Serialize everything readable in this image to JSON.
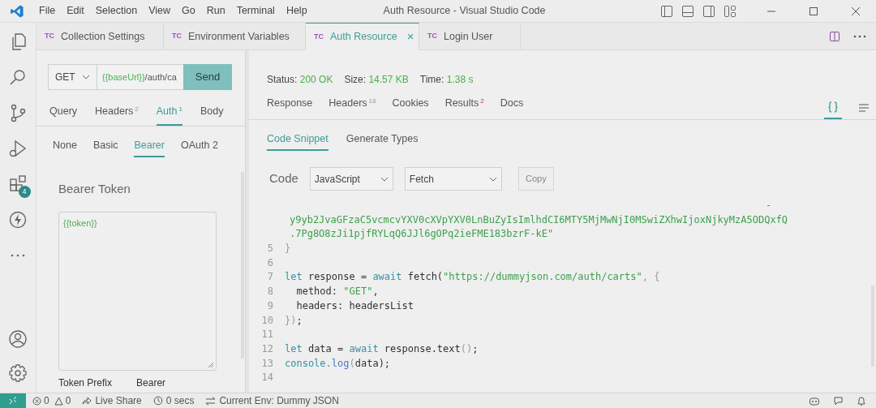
{
  "menu": [
    "File",
    "Edit",
    "Selection",
    "View",
    "Go",
    "Run",
    "Terminal",
    "Help"
  ],
  "window": {
    "title": "Auth Resource - Visual Studio Code"
  },
  "activity_bar": [
    {
      "kind": "files"
    },
    {
      "kind": "search"
    },
    {
      "kind": "scm"
    },
    {
      "kind": "debug"
    },
    {
      "kind": "extensions",
      "badge": "4"
    },
    {
      "kind": "bolt"
    },
    {
      "kind": "more"
    }
  ],
  "editor_tabs": [
    {
      "icon": "TC",
      "label": "Collection Settings",
      "selected": false
    },
    {
      "icon": "TC",
      "label": "Environment Variables",
      "selected": false
    },
    {
      "icon": "TC",
      "label": "Auth Resource",
      "selected": true,
      "close": "×"
    },
    {
      "icon": "TC",
      "label": "Login User",
      "selected": false
    }
  ],
  "request": {
    "method": "GET",
    "url_var": "{{baseUrl}}",
    "url_path": "/auth/ca",
    "send": "Send",
    "tabs": [
      {
        "label": "Query",
        "selected": false
      },
      {
        "label": "Headers",
        "count": "2",
        "selected": false
      },
      {
        "label": "Auth",
        "count": "1",
        "selected": true
      },
      {
        "label": "Body",
        "selected": false
      }
    ],
    "auth_types": [
      {
        "label": "None",
        "selected": false
      },
      {
        "label": "Basic",
        "selected": false
      },
      {
        "label": "Bearer",
        "selected": true
      },
      {
        "label": "OAuth 2",
        "selected": false
      }
    ],
    "token_label": "Bearer Token",
    "token_value": "{{token}}",
    "prefix_label": "Token Prefix",
    "prefix_value": "Bearer"
  },
  "response": {
    "status_label": "Status:",
    "status": "200 OK",
    "size_label": "Size:",
    "size": "14.57 KB",
    "time_label": "Time:",
    "time": "1.38 s",
    "tabs": [
      {
        "label": "Response",
        "selected": false
      },
      {
        "label": "Headers",
        "count": "18",
        "count_alert": false,
        "selected": false
      },
      {
        "label": "Cookies",
        "selected": false
      },
      {
        "label": "Results",
        "count": "2",
        "count_alert": true,
        "selected": false
      },
      {
        "label": "Docs",
        "selected": false
      }
    ],
    "subtabs": [
      {
        "label": "Code Snippet",
        "selected": true
      },
      {
        "label": "Generate Types",
        "selected": false
      }
    ],
    "code_label": "Code",
    "language": "JavaScript",
    "client": "Fetch",
    "copy": "Copy",
    "code_lines": [
      {
        "kind": "wrapmark",
        "segments": [
          {
            "text": "-",
            "kind": "str"
          }
        ]
      },
      {
        "kind": "wrap",
        "segments": [
          {
            "text": "y9yb2JvaGFzaC5vcmcvYXV0cXVpYXV0LnBuZyIsImlhdCI6MTY5MjMwNjI0MSwiZXhwIjoxNjkyMzA5ODQxfQ",
            "kind": "str"
          }
        ]
      },
      {
        "kind": "wrap",
        "segments": [
          {
            "text": ".7Pg8O8zJi1pjfRYLqQ6JJl6gOPq2ieFME183bzrF-kE\"",
            "kind": "str"
          }
        ]
      },
      {
        "kind": "line",
        "number": "5",
        "segments": [
          {
            "text": "}",
            "kind": "punct"
          }
        ]
      },
      {
        "kind": "line",
        "number": "6"
      },
      {
        "kind": "line",
        "number": "7",
        "segments": [
          {
            "text": "let ",
            "kind": "kw"
          },
          {
            "text": "response = ",
            "kind": "plain"
          },
          {
            "text": "await ",
            "kind": "kw"
          },
          {
            "text": "fetch(",
            "kind": "plain"
          },
          {
            "text": "\"https://dummyjson.com/auth/carts\"",
            "kind": "str"
          },
          {
            "text": ", {",
            "kind": "punct"
          }
        ]
      },
      {
        "kind": "line",
        "number": "8",
        "segments": [
          {
            "text": "  method: ",
            "kind": "plain"
          },
          {
            "text": "\"GET\"",
            "kind": "str"
          },
          {
            "text": ",",
            "kind": "plain"
          }
        ]
      },
      {
        "kind": "line",
        "number": "9",
        "segments": [
          {
            "text": "  headers: headersList",
            "kind": "plain"
          }
        ]
      },
      {
        "kind": "line",
        "number": "10",
        "segments": [
          {
            "text": "})",
            "kind": "punct"
          },
          {
            "text": ";",
            "kind": "plain"
          }
        ]
      },
      {
        "kind": "line",
        "number": "11"
      },
      {
        "kind": "line",
        "number": "12",
        "segments": [
          {
            "text": "let ",
            "kind": "kw"
          },
          {
            "text": "data = ",
            "kind": "plain"
          },
          {
            "text": "await ",
            "kind": "kw"
          },
          {
            "text": "response.text",
            "kind": "plain"
          },
          {
            "text": "()",
            "kind": "punct"
          },
          {
            "text": ";",
            "kind": "plain"
          }
        ]
      },
      {
        "kind": "line",
        "number": "13",
        "segments": [
          {
            "text": "console.",
            "kind": "kw"
          },
          {
            "text": "log",
            "kind": "fn"
          },
          {
            "text": "(",
            "kind": "punct"
          },
          {
            "text": "data",
            "kind": "plain"
          },
          {
            "text": ");",
            "kind": "plain"
          }
        ]
      },
      {
        "kind": "line",
        "number": "14"
      }
    ]
  },
  "status_bar": {
    "errors": "0",
    "warnings": "0",
    "live_share": "Live Share",
    "timer": "0 secs",
    "env": "Current Env: Dummy JSON"
  }
}
